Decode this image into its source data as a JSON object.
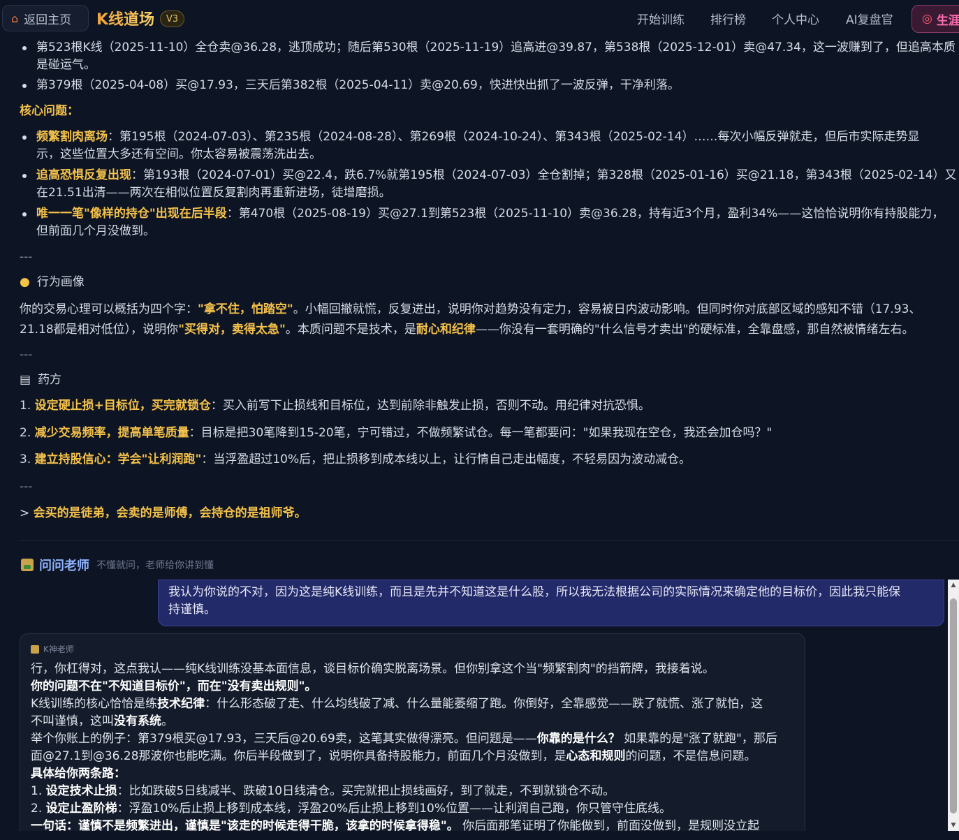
{
  "topbar": {
    "home_label": "返回主页",
    "brand": "K线道场",
    "version": "V3",
    "nav": [
      "开始训练",
      "排行榜",
      "个人中心",
      "AI复盘官"
    ],
    "cta_label": "生涯"
  },
  "analysis": {
    "good_trades": [
      {
        "text": "第523根K线（2025-11-10）全仓卖@36.28，逃顶成功；随后第530根（2025-11-19）追高进@39.87，第538根（2025-12-01）卖@47.34，这一波赚到了，但追高本质",
        "cont": "是碰运气。"
      },
      {
        "text": "第379根（2025-04-08）买@17.93，三天后第382根（2025-04-11）卖@20.69，快进快出抓了一波反弹，干净利落。"
      }
    ],
    "core_heading": "核心问题：",
    "core_issues": [
      {
        "label": "频繁割肉离场",
        "line1": "：第195根（2024-07-03）、第235根（2024-08-28）、第269根（2024-10-24）、第343根（2025-02-14）……每次小幅反弹就走，但后市实际走势显",
        "line2": "示，这些位置大多还有空间。你太容易被震荡洗出去。"
      },
      {
        "label": "追高恐惧反复出现",
        "line1": "：第193根（2024-07-01）买@22.4，跌6.7%就第195根（2024-07-03）全仓割掉；第328根（2025-01-16）买@21.18，第343根（2025-02-14）又",
        "line2": "在21.51出清——两次在相似位置反复割肉再重新进场，徒增磨损。"
      },
      {
        "label": "唯一一笔\"像样的持仓\"出现在后半段",
        "line1": "：第470根（2025-08-19）买@27.1到第523根（2025-11-10）卖@36.28，持有近3个月，盈利34%——这恰恰说明你有持股能力，",
        "line2": "但前面几个月没做到。"
      }
    ],
    "sep": "---",
    "portrait_icon": "lightbulb-icon",
    "portrait_title": "行为画像",
    "portrait": {
      "p1": "你的交易心理可以概括为四个字：",
      "h1": "\"拿不住，怕踏空\"",
      "p2": "。小幅回撤就慌，反复进出，说明你对趋势没有定力，容易被日内波动影响。但同时你对底部区域的感知不错（17.93、",
      "p3": "21.18都是相对低位），说明你",
      "h2": "\"买得对，卖得太急\"",
      "p4": "。本质问题不是技术，是",
      "h3": "耐心和纪律",
      "p5": "——你没有一套明确的\"什么信号才卖出\"的硬标准，全靠盘感，那自然被情绪左右。"
    },
    "prescription_icon": "clipboard-icon",
    "prescription_title": "药方",
    "prescriptions": [
      {
        "num": "1. ",
        "label": "设定硬止损+目标位，买完就锁仓",
        "text": "：买入前写下止损线和目标位，达到前除非触发止损，否则不动。用纪律对抗恐惧。"
      },
      {
        "num": "2. ",
        "label": "减少交易频率，提高单笔质量",
        "text": "：目标是把30笔降到15-20笔，宁可错过，不做频繁试仓。每一笔都要问：\"如果我现在空仓，我还会加仓吗？\""
      },
      {
        "num": "3. ",
        "label": "建立持股信心：学会\"让利润跑\"",
        "text": "：当浮盈超过10%后，把止损移到成本线以上，让行情自己走出幅度，不轻易因为波动减仓。"
      }
    ],
    "quote_prefix": "> ",
    "quote": "会买的是徒弟，会卖的是师傅，会持仓的是祖师爷。"
  },
  "ask": {
    "title": "问问老师",
    "subtitle": "不懂就问，老师给你讲到懂"
  },
  "chat": {
    "user_line1": "我认为你说的不对，因为这是纯K线训练，而且是先并不知道这是什么股，所以我无法根据公司的实际情况来确定他的目标价，因此我只能保",
    "user_line2": "持谨慎。",
    "teacher_name": "K神老师",
    "t1": "行，你杠得对，这点我认——纯K线训练没基本面信息，谈目标价确实脱离场景。但你别拿这个当\"频繁割肉\"的挡箭牌，我接着说。",
    "t2": "你的问题不在\"不知道目标价\"，而在\"没有卖出规则\"。",
    "t3a": "K线训练的核心恰恰是练",
    "t3b": "技术纪律",
    "t3c": "：什么形态破了走、什么均线破了减、什么量能萎缩了跑。你倒好，全靠感觉——跌了就慌、涨了就怕，这",
    "t4a": "不叫谨慎，这叫",
    "t4b": "没有系统",
    "t4c": "。",
    "t5a": "举个你账上的例子：第379根买@17.93，三天后@20.69卖，这笔其实做得漂亮。但问题是——",
    "t5b": "你靠的是什么？",
    "t5c": " 如果靠的是\"涨了就跑\"，那后",
    "t6a": "面@27.1到@36.28那波你也能吃满。你后半段做到了，说明你具备持股能力，前面几个月没做到，是",
    "t6b": "心态和规则",
    "t6c": "的问题，不是信息问题。",
    "t7": "具体给你两条路：",
    "t8a": "1. ",
    "t8b": "设定技术止损",
    "t8c": "：比如跌破5日线减半、跌破10日线清仓。买完就把止损线画好，到了就走，不到就锁仓不动。",
    "t9a": "2. ",
    "t9b": "设定止盈阶梯",
    "t9c": "：浮盈10%后止损上移到成本线，浮盈20%后止损上移到10%位置——让利润自己跑，你只管守住底线。",
    "t10a": "一句话：谨慎不是频繁进出，谨慎是\"该走的时候走得干脆，该拿的时候拿得稳\"。",
    "t10b": " 你后面那笔证明了你能做到，前面没做到，是规则没立起"
  },
  "colors": {
    "background": "#0d1423",
    "gold": "#f5c24b",
    "user_bubble": "#232a6a",
    "ask_title": "#8fb4ff"
  }
}
